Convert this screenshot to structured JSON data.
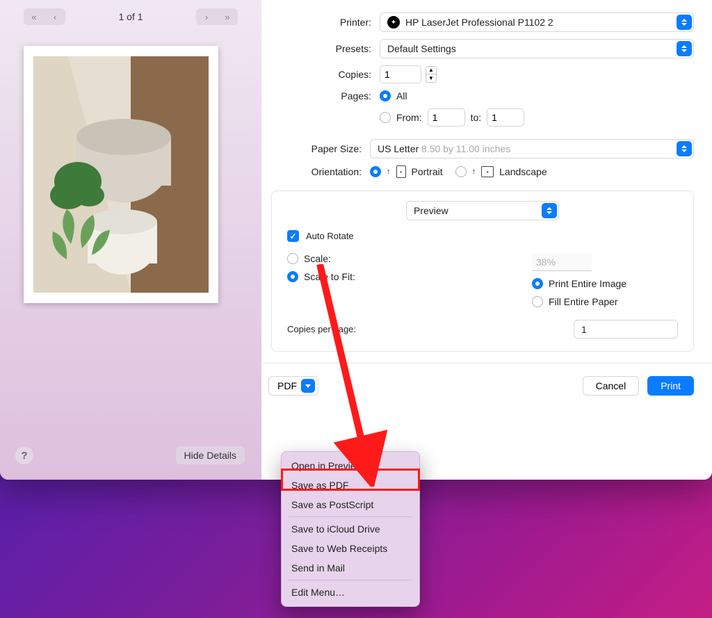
{
  "nav": {
    "page_indicator": "1 of 1"
  },
  "left": {
    "help": "?",
    "hide_details": "Hide Details"
  },
  "printer": {
    "label": "Printer:",
    "value": "HP LaserJet Professional P1102 2"
  },
  "presets": {
    "label": "Presets:",
    "value": "Default Settings"
  },
  "copies": {
    "label": "Copies:",
    "value": "1"
  },
  "pages": {
    "label": "Pages:",
    "all": "All",
    "from_label": "From:",
    "from_value": "1",
    "to_label": "to:",
    "to_value": "1"
  },
  "paper_size": {
    "label": "Paper Size:",
    "value": "US Letter",
    "hint": "8.50 by 11.00 inches"
  },
  "orientation": {
    "label": "Orientation:",
    "portrait": "Portrait",
    "landscape": "Landscape"
  },
  "sub": {
    "section": "Preview",
    "auto_rotate": "Auto Rotate",
    "scale": "Scale:",
    "scale_value": "38%",
    "scale_fit": "Scale to Fit:",
    "print_entire": "Print Entire Image",
    "fill_paper": "Fill Entire Paper",
    "copies_per_page": "Copies per page:",
    "copies_per_page_value": "1"
  },
  "footer": {
    "pdf": "PDF",
    "cancel": "Cancel",
    "print": "Print"
  },
  "pdf_menu": {
    "open_preview": "Open in Preview",
    "save_pdf": "Save as PDF",
    "save_ps": "Save as PostScript",
    "icloud": "Save to iCloud Drive",
    "web_receipts": "Save to Web Receipts",
    "send_mail": "Send in Mail",
    "edit_menu": "Edit Menu…"
  }
}
